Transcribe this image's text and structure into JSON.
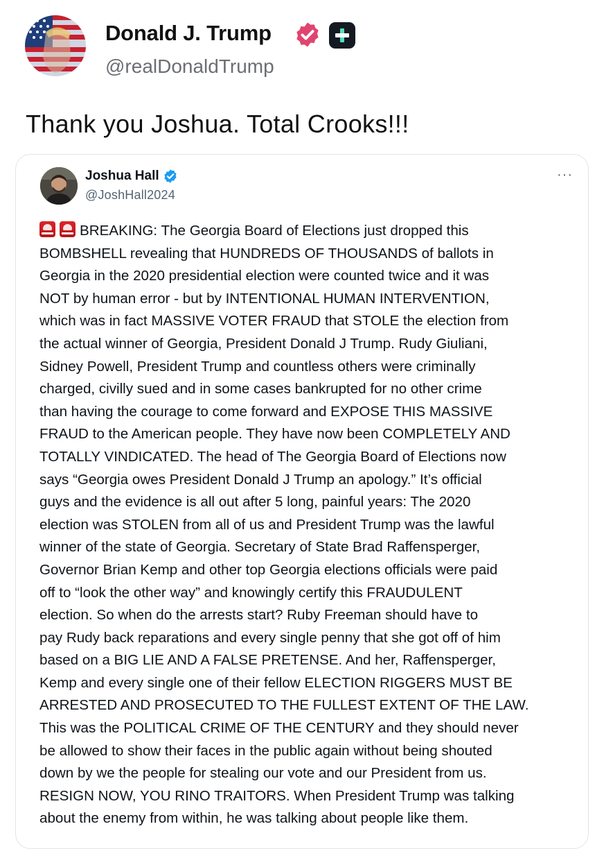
{
  "post": {
    "author_name": "Donald J. Trump",
    "author_handle": "@realDonaldTrump",
    "text": "Thank you Joshua. Total Crooks!!!"
  },
  "quote": {
    "author_name": "Joshua Hall",
    "author_handle": "@JoshHall2024",
    "more_label": "···",
    "emoji": [
      "siren-emoji",
      "siren-emoji"
    ],
    "lines": [
      "BREAKING: The Georgia Board of Elections just dropped this",
      "BOMBSHELL revealing that HUNDREDS OF THOUSANDS of ballots in",
      "Georgia in the 2020 presidential election were counted twice and it was",
      "NOT by human error - but by INTENTIONAL HUMAN INTERVENTION,",
      "which was in fact MASSIVE VOTER FRAUD that STOLE the election from",
      "the actual winner of Georgia, President Donald J Trump. Rudy Giuliani,",
      "Sidney Powell, President Trump and countless others were criminally",
      "charged, civilly sued and in some cases bankrupted for no other crime",
      "than having the courage to come forward and EXPOSE THIS MASSIVE",
      "FRAUD to the American people. They have now been COMPLETELY AND",
      "TOTALLY VINDICATED. The head of The Georgia Board of Elections now",
      "says “Georgia owes President Donald J Trump an apology.” It’s official",
      "guys and the evidence is all out after 5 long, painful years: The 2020",
      "election was STOLEN from all of us and President Trump was the lawful",
      "winner of the state of Georgia. Secretary of State Brad Raffensperger,",
      "Governor Brian Kemp and other top Georgia elections officials were paid",
      "off to “look the other way” and knowingly certify this FRAUDULENT",
      "election. So when do the arrests start? Ruby Freeman should have to",
      "pay Rudy back reparations and every single penny that she got off of him",
      "based on a BIG LIE AND A FALSE PRETENSE. And her, Raffensperger,",
      "Kemp and every single one of their fellow ELECTION RIGGERS MUST BE",
      "ARRESTED AND PROSECUTED TO THE FULLEST EXTENT OF THE LAW.",
      "This was the POLITICAL CRIME OF THE CENTURY and they should never",
      "be allowed to show their faces in the public again without being shouted",
      "down by we the people for stealing our vote and our President from us.",
      "RESIGN NOW, YOU RINO TRAITORS. When President Trump was talking",
      "about the enemy from within, he was talking about people like them."
    ]
  },
  "colors": {
    "verified_main": "#e0456f",
    "verified_quote": "#1d9bf0",
    "plus_badge": "#151a22",
    "secondary_text": "#536471"
  }
}
